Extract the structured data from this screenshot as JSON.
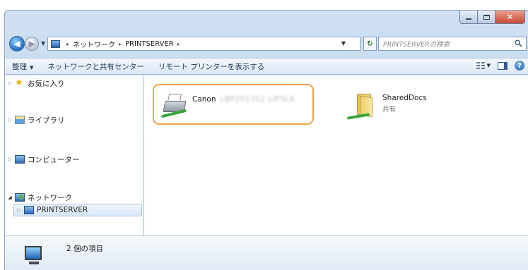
{
  "window": {
    "caption_buttons": {
      "minimize": "—",
      "maximize": "□",
      "close": "✕"
    }
  },
  "nav": {
    "back_icon": "arrow-left-icon",
    "forward_icon": "arrow-right-icon"
  },
  "address": {
    "breadcrumbs": [
      "ネットワーク",
      "PRINTSERVER"
    ],
    "separator": "▸",
    "refresh_icon": "refresh-icon"
  },
  "search": {
    "placeholder": "PRINTSERVERの検索",
    "icon": "magnifier-icon"
  },
  "toolbar": {
    "organize": "整理",
    "network_center": "ネットワークと共有センター",
    "remote_printers": "リモート プリンターを表示する"
  },
  "sidebar": {
    "items": [
      {
        "label": "お気に入り",
        "icon": "star-icon"
      },
      {
        "label": "ライブラリ",
        "icon": "library-icon"
      },
      {
        "label": "コンピューター",
        "icon": "computer-icon"
      },
      {
        "label": "ネットワーク",
        "icon": "network-icon"
      },
      {
        "label": "PRINTSERVER",
        "icon": "server-icon"
      }
    ]
  },
  "content": {
    "items": [
      {
        "name": "Canon",
        "name_obscured": "LBP251352 LIPSLX",
        "icon": "network-printer-icon",
        "highlight_color": "#f0a048"
      },
      {
        "name": "SharedDocs",
        "subtitle": "共有",
        "icon": "shared-folder-icon"
      }
    ]
  },
  "details": {
    "count_text": "2 個の項目",
    "icon": "network-computer-icon"
  },
  "colors": {
    "highlight": "#f0a048",
    "chrome": "#bcd1ea",
    "close": "#c74b34"
  }
}
